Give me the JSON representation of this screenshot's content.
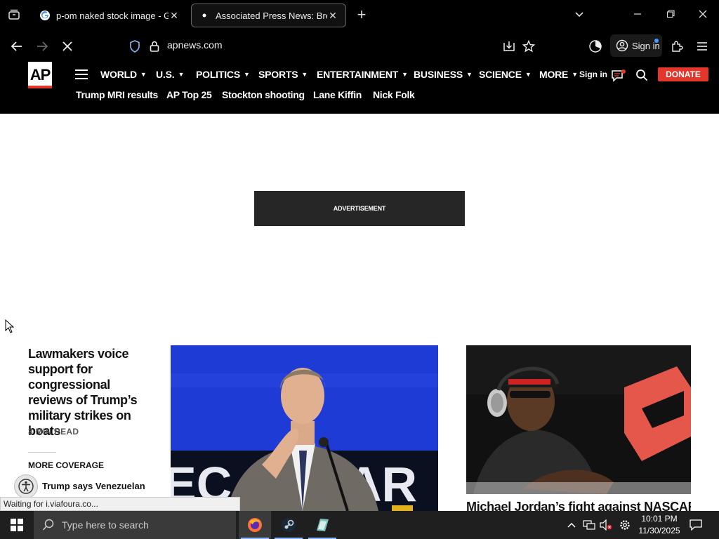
{
  "browser": {
    "tabs": [
      {
        "title": "p-om naked stock image - Goo",
        "active": false,
        "favicon": "google-icon"
      },
      {
        "title": "Associated Press News: Breakin",
        "active": true,
        "favicon": "loading-dot-icon"
      }
    ],
    "url": "apnews.com",
    "signin_label": "Sign in",
    "status_text": "Waiting for i.viafoura.co..."
  },
  "ap": {
    "logo_text": "AP",
    "nav": [
      {
        "label": "WORLD"
      },
      {
        "label": "U.S."
      },
      {
        "label": "POLITICS"
      },
      {
        "label": "SPORTS"
      },
      {
        "label": "ENTERTAINMENT"
      },
      {
        "label": "BUSINESS"
      },
      {
        "label": "SCIENCE"
      },
      {
        "label": "MORE"
      }
    ],
    "signin_label": "Sign in",
    "donate_label": "DONATE",
    "trending": [
      "Trump MRI results",
      "AP Top 25",
      "Stockton shooting",
      "Lane Kiffin",
      "Nick Folk"
    ],
    "brand_red": "#e4372b"
  },
  "ad": {
    "label": "ADVERTISEMENT"
  },
  "lead_story": {
    "headline": "Lawmakers voice support for congressional reviews of Trump’s military strikes on boats",
    "read_time": "3 MIN READ",
    "more_coverage_label": "MORE COVERAGE",
    "sub_story": "Trump says Venezuelan"
  },
  "side_story": {
    "headline": "Michael Jordan’s fight against NASCAR"
  },
  "taskbar": {
    "search_placeholder": "Type here to search",
    "time": "10:01 PM",
    "date": "11/30/2025"
  }
}
